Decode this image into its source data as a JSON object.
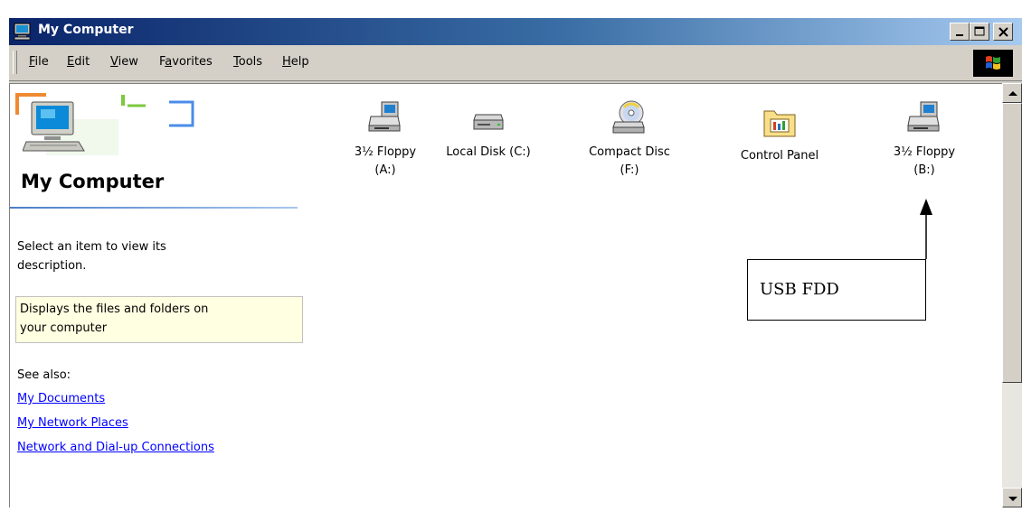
{
  "window": {
    "title": "My Computer",
    "title_color": "#ffffff",
    "titlebar_gradient": [
      "#0a246a",
      "#a6caf0"
    ]
  },
  "menu": {
    "file": {
      "accel": "F",
      "rest": "ile"
    },
    "edit": {
      "accel": "E",
      "rest": "dit"
    },
    "view": {
      "accel": "V",
      "rest": "iew"
    },
    "favorites": {
      "pre": "F",
      "accel": "a",
      "rest": "vorites"
    },
    "tools": {
      "accel": "T",
      "rest": "ools"
    },
    "help": {
      "accel": "H",
      "rest": "elp"
    }
  },
  "sidebar": {
    "heading": "My Computer",
    "prompt_line1": "Select an item to view its",
    "prompt_line2": "description.",
    "desc_line1": "Displays the files and folders on",
    "desc_line2": "your computer",
    "see_also": "See also:",
    "links": [
      "My Documents",
      "My Network Places",
      "Network and Dial-up Connections"
    ],
    "link_color": "#0000ff",
    "desc_bg": "#ffffe1"
  },
  "drives": [
    {
      "line1": "3½ Floppy",
      "line2": "(A:)",
      "icon": "floppy-drive-icon"
    },
    {
      "line1": "Local Disk (C:)",
      "line2": "",
      "icon": "hard-disk-icon"
    },
    {
      "line1": "Compact Disc",
      "line2": "(F:)",
      "icon": "cd-drive-icon"
    },
    {
      "line1": "Control Panel",
      "line2": "",
      "icon": "control-panel-icon"
    },
    {
      "line1": "3½ Floppy",
      "line2": "(B:)",
      "icon": "floppy-drive-icon"
    }
  ],
  "annotation": {
    "text": "USB FDD"
  }
}
